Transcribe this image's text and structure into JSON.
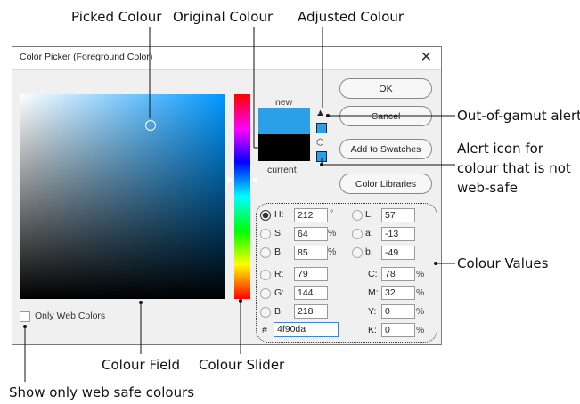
{
  "annotations": {
    "picked_colour": "Picked Colour",
    "original_colour": "Original Colour",
    "adjusted_colour": "Adjusted Colour",
    "out_of_gamut": "Out-of-gamut alert",
    "web_safe_alert": "Alert icon for colour that is not web-safe",
    "colour_values": "Colour Values",
    "colour_field": "Colour Field",
    "colour_slider": "Colour Slider",
    "web_safe_only": "Show only web safe colours"
  },
  "dialog": {
    "title": "Color Picker (Foreground Color)",
    "close_glyph": "✕",
    "new_label": "new",
    "current_label": "current",
    "buttons": {
      "ok": "OK",
      "cancel": "Cancel",
      "add_to_swatches": "Add to Swatches",
      "color_libraries": "Color Libraries"
    },
    "only_web_colors": "Only Web Colors",
    "values": {
      "H": {
        "label": "H:",
        "value": "212",
        "unit": "°"
      },
      "S": {
        "label": "S:",
        "value": "64",
        "unit": "%"
      },
      "Bv": {
        "label": "B:",
        "value": "85",
        "unit": "%"
      },
      "R": {
        "label": "R:",
        "value": "79"
      },
      "G": {
        "label": "G:",
        "value": "144"
      },
      "Bc": {
        "label": "B:",
        "value": "218"
      },
      "L": {
        "label": "L:",
        "value": "57"
      },
      "a": {
        "label": "a:",
        "value": "-13"
      },
      "b": {
        "label": "b:",
        "value": "-49"
      },
      "C": {
        "label": "C:",
        "value": "78",
        "unit": "%"
      },
      "M": {
        "label": "M:",
        "value": "32",
        "unit": "%"
      },
      "Y": {
        "label": "Y:",
        "value": "0",
        "unit": "%"
      },
      "K": {
        "label": "K:",
        "value": "0",
        "unit": "%"
      },
      "hex_label": "#",
      "hex": "4f90da"
    }
  },
  "colors": {
    "new_swatch": "#2b9fe7",
    "current_swatch": "#000000",
    "field_hue": "#0097ff"
  },
  "icons": {
    "warning": "warning-triangle-icon",
    "web_safe": "cube-icon",
    "close": "close-icon"
  }
}
